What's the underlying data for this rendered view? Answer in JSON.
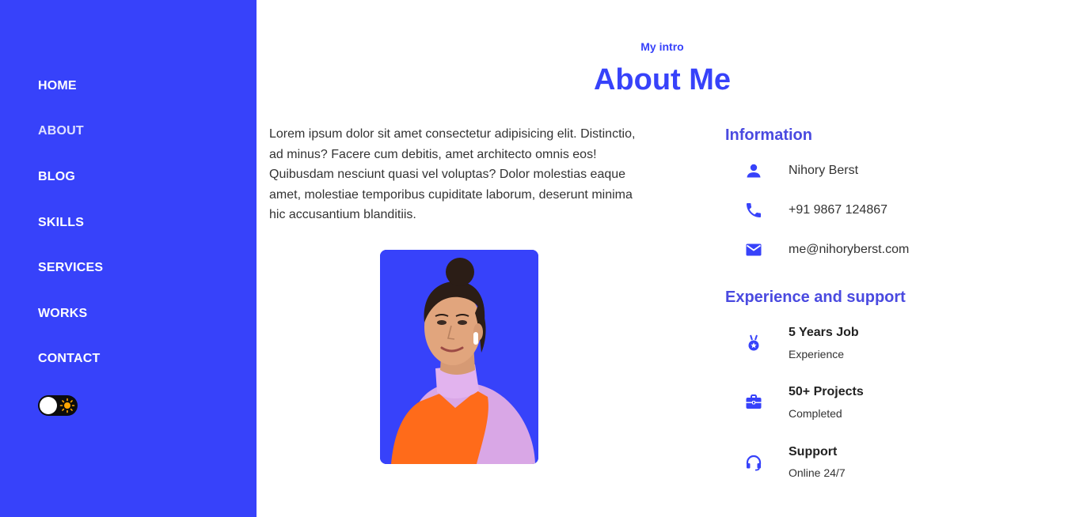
{
  "nav": {
    "items": [
      {
        "label": "HOME"
      },
      {
        "label": "ABOUT"
      },
      {
        "label": "BLOG"
      },
      {
        "label": "SKILLS"
      },
      {
        "label": "SERVICES"
      },
      {
        "label": "WORKS"
      },
      {
        "label": "CONTACT"
      }
    ],
    "active_item": "ABOUT",
    "theme_toggle": {
      "icon": "sun-icon",
      "state": "light"
    }
  },
  "header": {
    "subtitle": "My intro",
    "title": "About Me"
  },
  "intro": {
    "text": "Lorem ipsum dolor sit amet consectetur adipisicing elit. Distinctio, ad minus? Facere cum debitis, amet architecto omnis eos! Quibusdam nesciunt quasi vel voluptas? Dolor molestias eaque amet, molestiae temporibus cupiditate laborum, deserunt minima hic accusantium blanditiis."
  },
  "information": {
    "heading": "Information",
    "items": [
      {
        "icon": "user-icon",
        "text": "Nihory Berst"
      },
      {
        "icon": "phone-icon",
        "text": "+91 9867 124867"
      },
      {
        "icon": "mail-icon",
        "text": "me@nihoryberst.com"
      }
    ]
  },
  "experience": {
    "heading": "Experience and support",
    "items": [
      {
        "icon": "medal-icon",
        "title": "5 Years Job",
        "subtitle": "Experience"
      },
      {
        "icon": "briefcase-icon",
        "title": "50+ Projects",
        "subtitle": "Completed"
      },
      {
        "icon": "headset-icon",
        "title": "Support",
        "subtitle": "Online 24/7"
      }
    ]
  },
  "colors": {
    "primary": "#3742fa",
    "heading": "#4a4ae0",
    "text": "#333333",
    "toggle_bg": "#0c0c0c",
    "sun": "#ffa502"
  }
}
